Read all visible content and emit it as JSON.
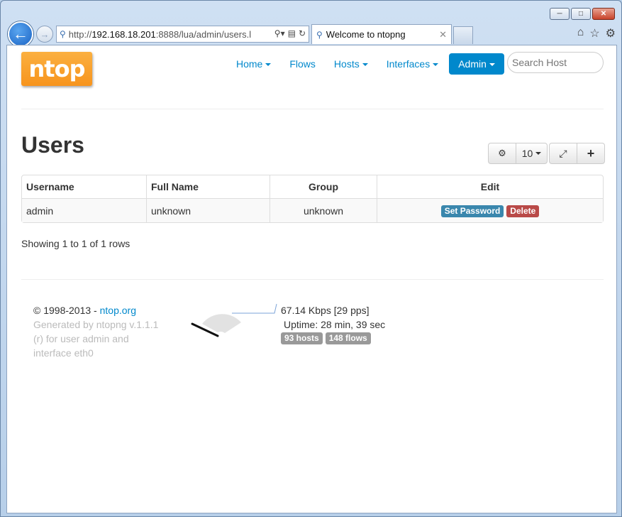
{
  "browser": {
    "url_prefix": "http://",
    "url_host": "192.168.18.201",
    "url_rest": ":8888/lua/admin/users.l",
    "tab_title": "Welcome to ntopng",
    "icons": [
      "back-arrow-icon",
      "forward-arrow-icon",
      "search-icon",
      "refresh-icon",
      "home-icon",
      "star-icon",
      "gear-icon"
    ]
  },
  "header": {
    "logo_text": "ntop",
    "nav": {
      "home": "Home",
      "flows": "Flows",
      "hosts": "Hosts",
      "interfaces": "Interfaces",
      "admin": "Admin"
    },
    "search_placeholder": "Search Host",
    "accent_color": "#0088cc"
  },
  "main": {
    "title": "Users",
    "toolbar": {
      "page_size": "10"
    },
    "table": {
      "columns": [
        "Username",
        "Full Name",
        "Group",
        "Edit"
      ],
      "rows": [
        {
          "username": "admin",
          "full_name": "unknown",
          "group": "unknown",
          "actions": [
            "Set Password",
            "Delete"
          ]
        }
      ]
    },
    "pagination_text": "Showing 1 to 1 of 1 rows"
  },
  "footer": {
    "copyright": "© 1998-2013 - ",
    "copyright_link": "ntop.org",
    "generated_by": "Generated by ntopng v.1.1.1",
    "generated_for": "(r) for user admin and",
    "generated_interface": "interface eth0",
    "throughput": "67.14 Kbps [29 pps]",
    "uptime": "Uptime: 28 min, 39 sec",
    "hosts_badge": "93 hosts",
    "flows_badge": "148 flows"
  }
}
